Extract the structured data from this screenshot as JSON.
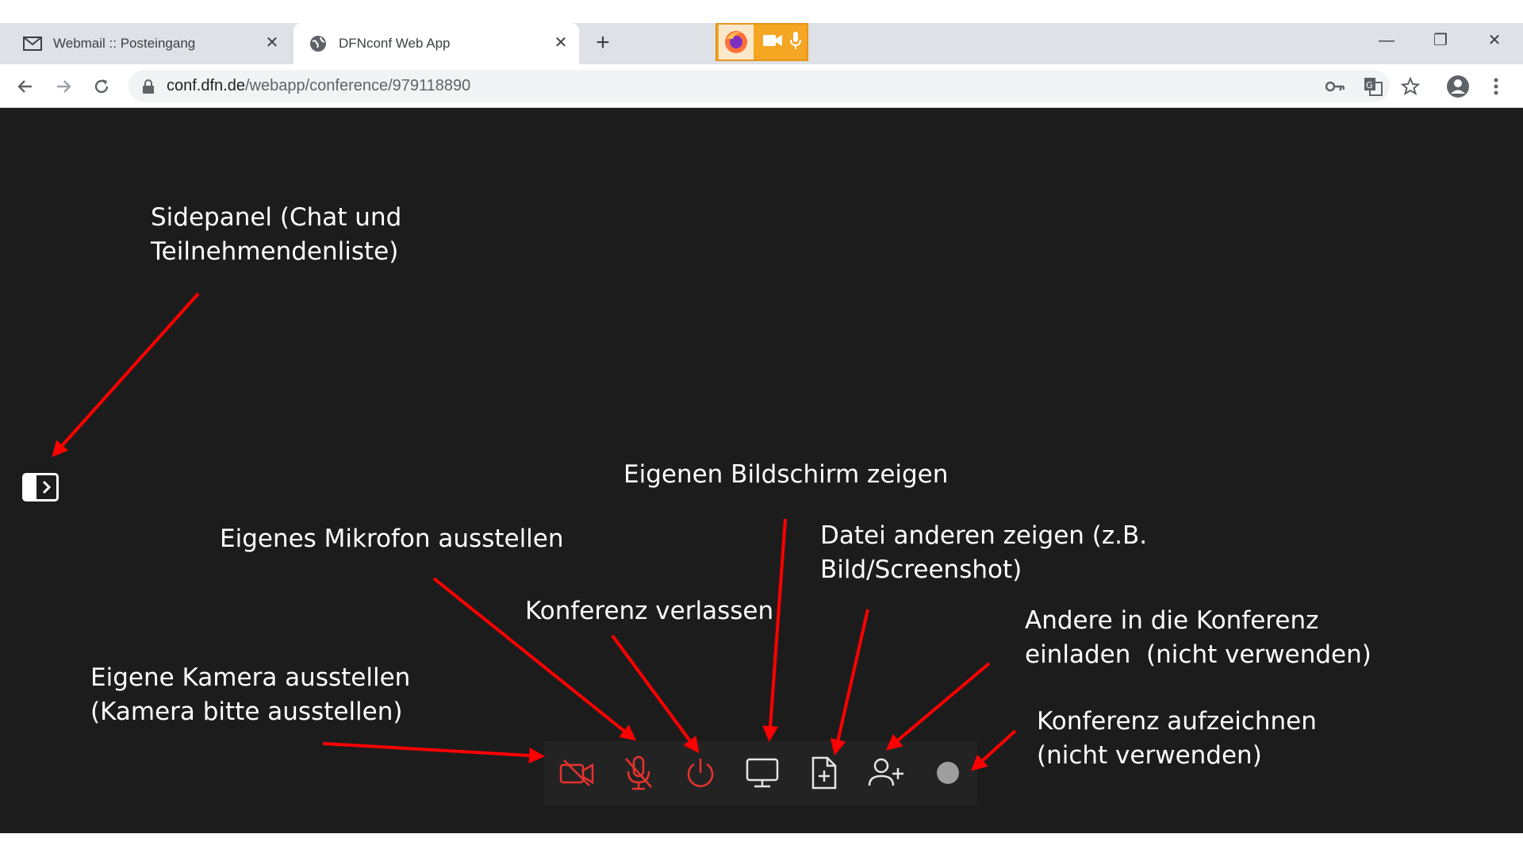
{
  "tabs": [
    {
      "title": "Webmail :: Posteingang",
      "icon": "mail-icon"
    },
    {
      "title": "DFNconf Web App",
      "icon": "globe-icon"
    }
  ],
  "address": {
    "domain": "conf.dfn.de",
    "path": "/webapp/conference/979118890"
  },
  "annotations": {
    "sidepanel": "Sidepanel (Chat und\nTeilnehmendenliste)",
    "screen": "Eigenen Bildschirm zeigen",
    "mic": "Eigenes Mikrofon ausstellen",
    "file": "Datei anderen zeigen (z.B.\nBild/Screenshot)",
    "leave": "Konferenz verlassen",
    "invite": "Andere in die Konferenz\neinladen  (nicht verwenden)",
    "camera": "Eigene Kamera ausstellen\n(Kamera bitte ausstellen)",
    "record": "Konferenz aufzeichnen\n(nicht verwenden)"
  },
  "colors": {
    "accent_red": "#e8322e",
    "arrow_red": "#ff0000",
    "page_bg": "#1d1c1d",
    "media_indicator": "#f5a623"
  },
  "controls": [
    {
      "name": "camera-off-button",
      "icon": "camera-off-icon"
    },
    {
      "name": "mic-off-button",
      "icon": "mic-off-icon"
    },
    {
      "name": "leave-button",
      "icon": "power-icon"
    },
    {
      "name": "share-screen-button",
      "icon": "monitor-icon"
    },
    {
      "name": "share-file-button",
      "icon": "file-plus-icon"
    },
    {
      "name": "invite-button",
      "icon": "user-plus-icon"
    },
    {
      "name": "record-button",
      "icon": "record-icon"
    }
  ]
}
